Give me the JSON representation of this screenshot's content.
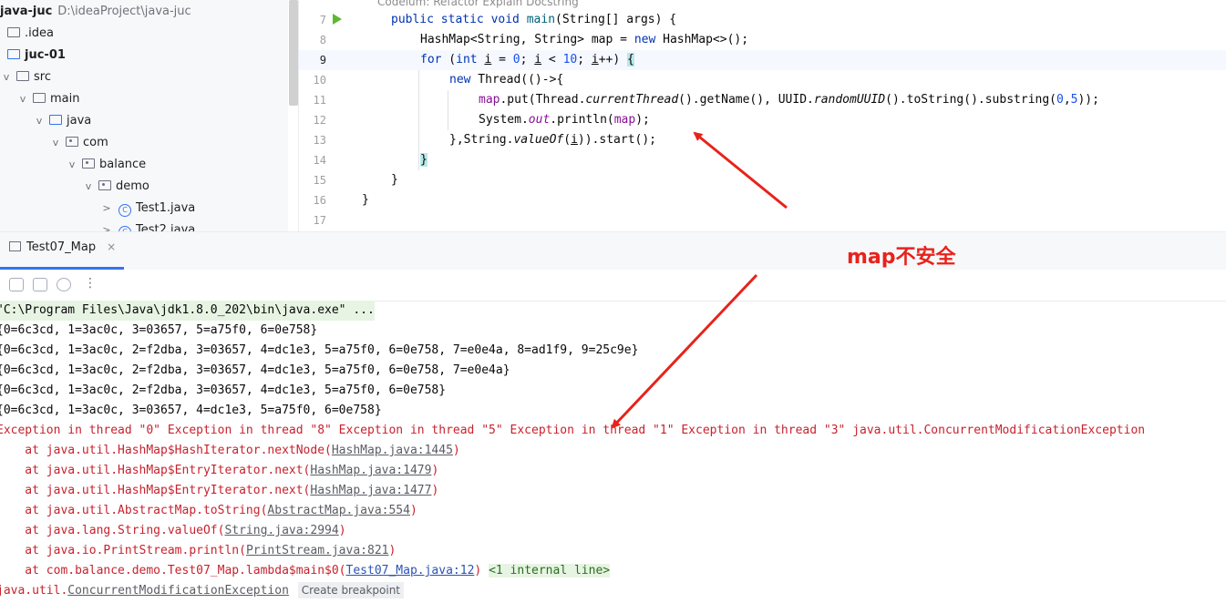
{
  "project": {
    "name": "java-juc",
    "path": "D:\\ideaProject\\java-juc",
    "items": [
      {
        "label": ".idea",
        "indent": 0,
        "arrow": "",
        "icon": "folder"
      },
      {
        "label": "juc-01",
        "indent": 0,
        "arrow": "",
        "icon": "module",
        "bold": true
      },
      {
        "label": "src",
        "indent": 1,
        "arrow": "v",
        "icon": "folder"
      },
      {
        "label": "main",
        "indent": 2,
        "arrow": "v",
        "icon": "folder"
      },
      {
        "label": "java",
        "indent": 3,
        "arrow": "v",
        "icon": "source"
      },
      {
        "label": "com",
        "indent": 4,
        "arrow": "v",
        "icon": "package"
      },
      {
        "label": "balance",
        "indent": 5,
        "arrow": "v",
        "icon": "package"
      },
      {
        "label": "demo",
        "indent": 6,
        "arrow": "v",
        "icon": "package"
      },
      {
        "label": "Test1.java",
        "indent": 7,
        "arrow": ">",
        "icon": "class"
      },
      {
        "label": "Test2.java",
        "indent": 7,
        "arrow": ">",
        "icon": "class"
      }
    ]
  },
  "editor": {
    "inlay_hint": "Codeium: Refactor  Explain  Docstring",
    "line_numbers": [
      "7",
      "8",
      "9",
      "10",
      "11",
      "12",
      "13",
      "14",
      "15",
      "16",
      "17"
    ]
  },
  "run": {
    "tab_label": "Test07_Map",
    "close_glyph": "×",
    "more_glyph": "⋮",
    "command": "\"C:\\Program Files\\Java\\jdk1.8.0_202\\bin\\java.exe\" ...",
    "output_lines": [
      "{0=6c3cd, 1=3ac0c, 3=03657, 5=a75f0, 6=0e758}",
      "{0=6c3cd, 1=3ac0c, 2=f2dba, 3=03657, 4=dc1e3, 5=a75f0, 6=0e758, 7=e0e4a, 8=ad1f9, 9=25c9e}",
      "{0=6c3cd, 1=3ac0c, 2=f2dba, 3=03657, 4=dc1e3, 5=a75f0, 6=0e758, 7=e0e4a}",
      "{0=6c3cd, 1=3ac0c, 2=f2dba, 3=03657, 4=dc1e3, 5=a75f0, 6=0e758}",
      "{0=6c3cd, 1=3ac0c, 3=03657, 4=dc1e3, 5=a75f0, 6=0e758}"
    ],
    "exception_line": "Exception in thread \"0\" Exception in thread \"8\" Exception in thread \"5\" Exception in thread \"1\" Exception in thread \"3\" java.util.ConcurrentModificationException",
    "stack": [
      {
        "prefix": "    at java.util.HashMap$HashIterator.nextNode(",
        "link": "HashMap.java:1445",
        "suffix": ")"
      },
      {
        "prefix": "    at java.util.HashMap$EntryIterator.next(",
        "link": "HashMap.java:1479",
        "suffix": ")"
      },
      {
        "prefix": "    at java.util.HashMap$EntryIterator.next(",
        "link": "HashMap.java:1477",
        "suffix": ")"
      },
      {
        "prefix": "    at java.util.AbstractMap.toString(",
        "link": "AbstractMap.java:554",
        "suffix": ")"
      },
      {
        "prefix": "    at java.lang.String.valueOf(",
        "link": "String.java:2994",
        "suffix": ")"
      },
      {
        "prefix": "    at java.io.PrintStream.println(",
        "link": "PrintStream.java:821",
        "suffix": ")"
      }
    ],
    "last_frame": {
      "prefix": "    at com.balance.demo.Test07_Map.lambda$main$0(",
      "link": "Test07_Map.java:12",
      "suffix": ")",
      "internal": "<1 internal line>"
    },
    "caused": {
      "prefix": "java.util.",
      "link": "ConcurrentModificationException",
      "breakpoint": "Create breakpoint"
    }
  },
  "annotation": {
    "text": "map不安全",
    "color": "#e8221b"
  },
  "colors": {
    "keyword": "#0033b3",
    "number": "#1750eb",
    "field": "#871094",
    "error": "#c7222d",
    "accent": "#3574f0"
  }
}
